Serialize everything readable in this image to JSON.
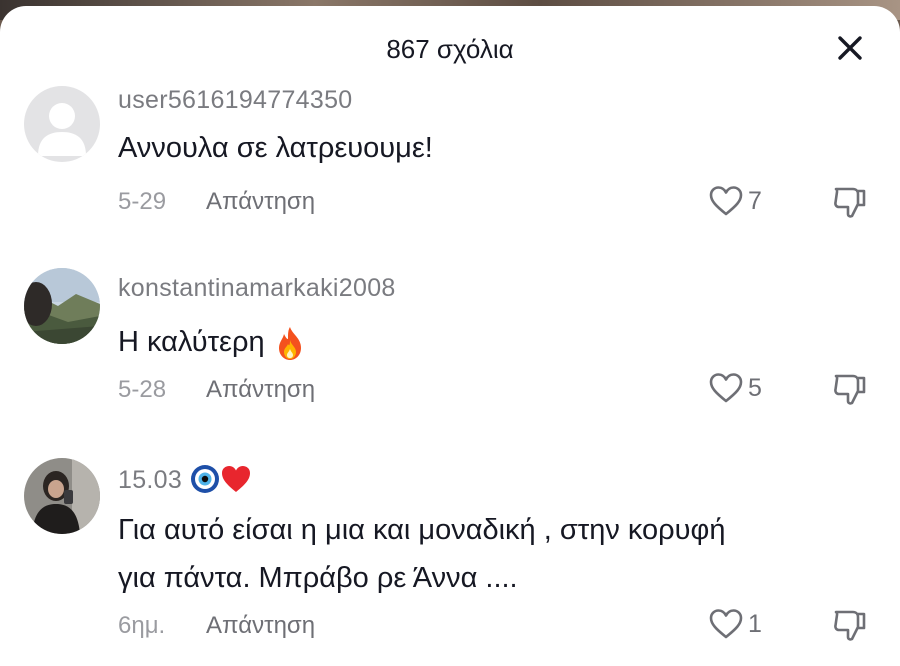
{
  "header": {
    "title": "867 σχόλια"
  },
  "comments": [
    {
      "username": "user5616194774350",
      "text": "Αννουλα σε λατρευουμε!",
      "date": "5-29",
      "reply_label": "Απάντηση",
      "likes": "7"
    },
    {
      "username": "konstantinamarkaki2008",
      "text": "Η καλύτερη",
      "date": "5-28",
      "reply_label": "Απάντηση",
      "likes": "5"
    },
    {
      "username": "15.03",
      "username_emojis": "🧿❤️",
      "text_line1": "Για αυτό είσαι η μια και μοναδική , στην κορυφή",
      "text_line2": "για πάντα. Μπράβο ρε Άννα ....",
      "date": "6ημ.",
      "reply_label": "Απάντηση",
      "likes": "1"
    }
  ],
  "icons": {
    "close": "close-icon",
    "like": "heart-outline-icon",
    "dislike": "thumbs-down-icon",
    "fire": "fire-emoji"
  }
}
